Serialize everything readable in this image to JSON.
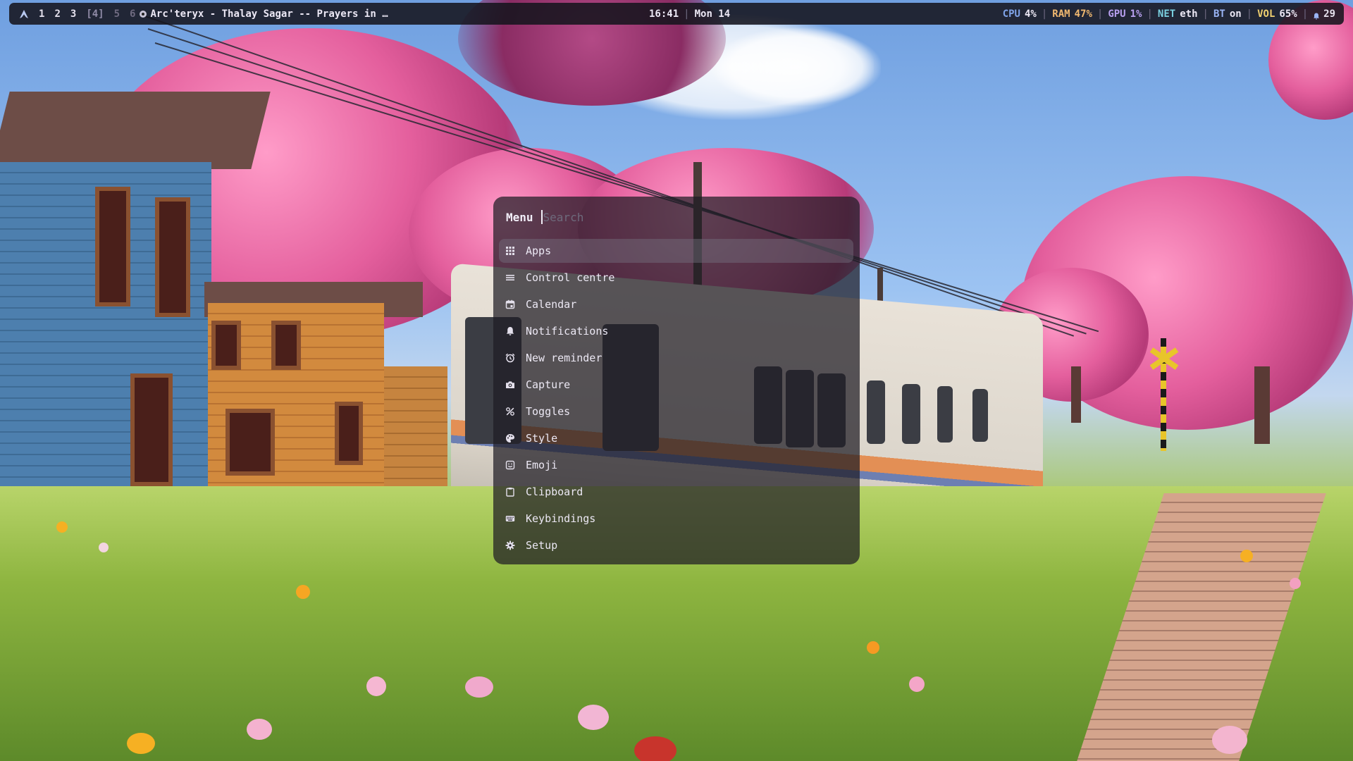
{
  "topbar": {
    "logo_icon": "arch-logo-icon",
    "workspaces": [
      "1",
      "2",
      "3",
      "[4]",
      "5",
      "6"
    ],
    "active_workspace": "[4]",
    "media_icon": "music-disc-icon",
    "window_title": "Arc'teryx - Thalay Sagar -- Prayers in …",
    "time": "16:41",
    "date": "Mon 14",
    "separator": "|",
    "stats": {
      "cpu_label": "CPU",
      "cpu_value": "4%",
      "ram_label": "RAM",
      "ram_value": "47%",
      "gpu_label": "GPU",
      "gpu_value": "1%",
      "net_label": "NET",
      "net_value": "eth",
      "bt_label": "BT",
      "bt_value": "on",
      "vol_label": "VOL",
      "vol_value": "65%",
      "notifications_icon": "bell-icon",
      "notifications_count": "29"
    },
    "colors": {
      "cpu": "#7fa3e8",
      "ram": "#f0b870",
      "gpu": "#b8a0f0",
      "net": "#7ad0e0",
      "bt": "#9ab4f5",
      "vol": "#f0d070"
    }
  },
  "launcher": {
    "title": "Menu",
    "search_placeholder": "Search",
    "search_value": "",
    "items": [
      {
        "label": "Apps",
        "icon": "grid-icon",
        "selected": true
      },
      {
        "label": "Control centre",
        "icon": "menu-lines-icon",
        "selected": false
      },
      {
        "label": "Calendar",
        "icon": "calendar-icon",
        "selected": false
      },
      {
        "label": "Notifications",
        "icon": "bell-icon",
        "selected": false
      },
      {
        "label": "New reminder",
        "icon": "alarm-clock-icon",
        "selected": false
      },
      {
        "label": "Capture",
        "icon": "camera-icon",
        "selected": false
      },
      {
        "label": "Toggles",
        "icon": "toggle-slash-icon",
        "selected": false
      },
      {
        "label": "Style",
        "icon": "palette-icon",
        "selected": false
      },
      {
        "label": "Emoji",
        "icon": "emoji-icon",
        "selected": false
      },
      {
        "label": "Clipboard",
        "icon": "clipboard-icon",
        "selected": false
      },
      {
        "label": "Keybindings",
        "icon": "keyboard-icon",
        "selected": false
      },
      {
        "label": "Setup",
        "icon": "gear-icon",
        "selected": false
      }
    ]
  }
}
